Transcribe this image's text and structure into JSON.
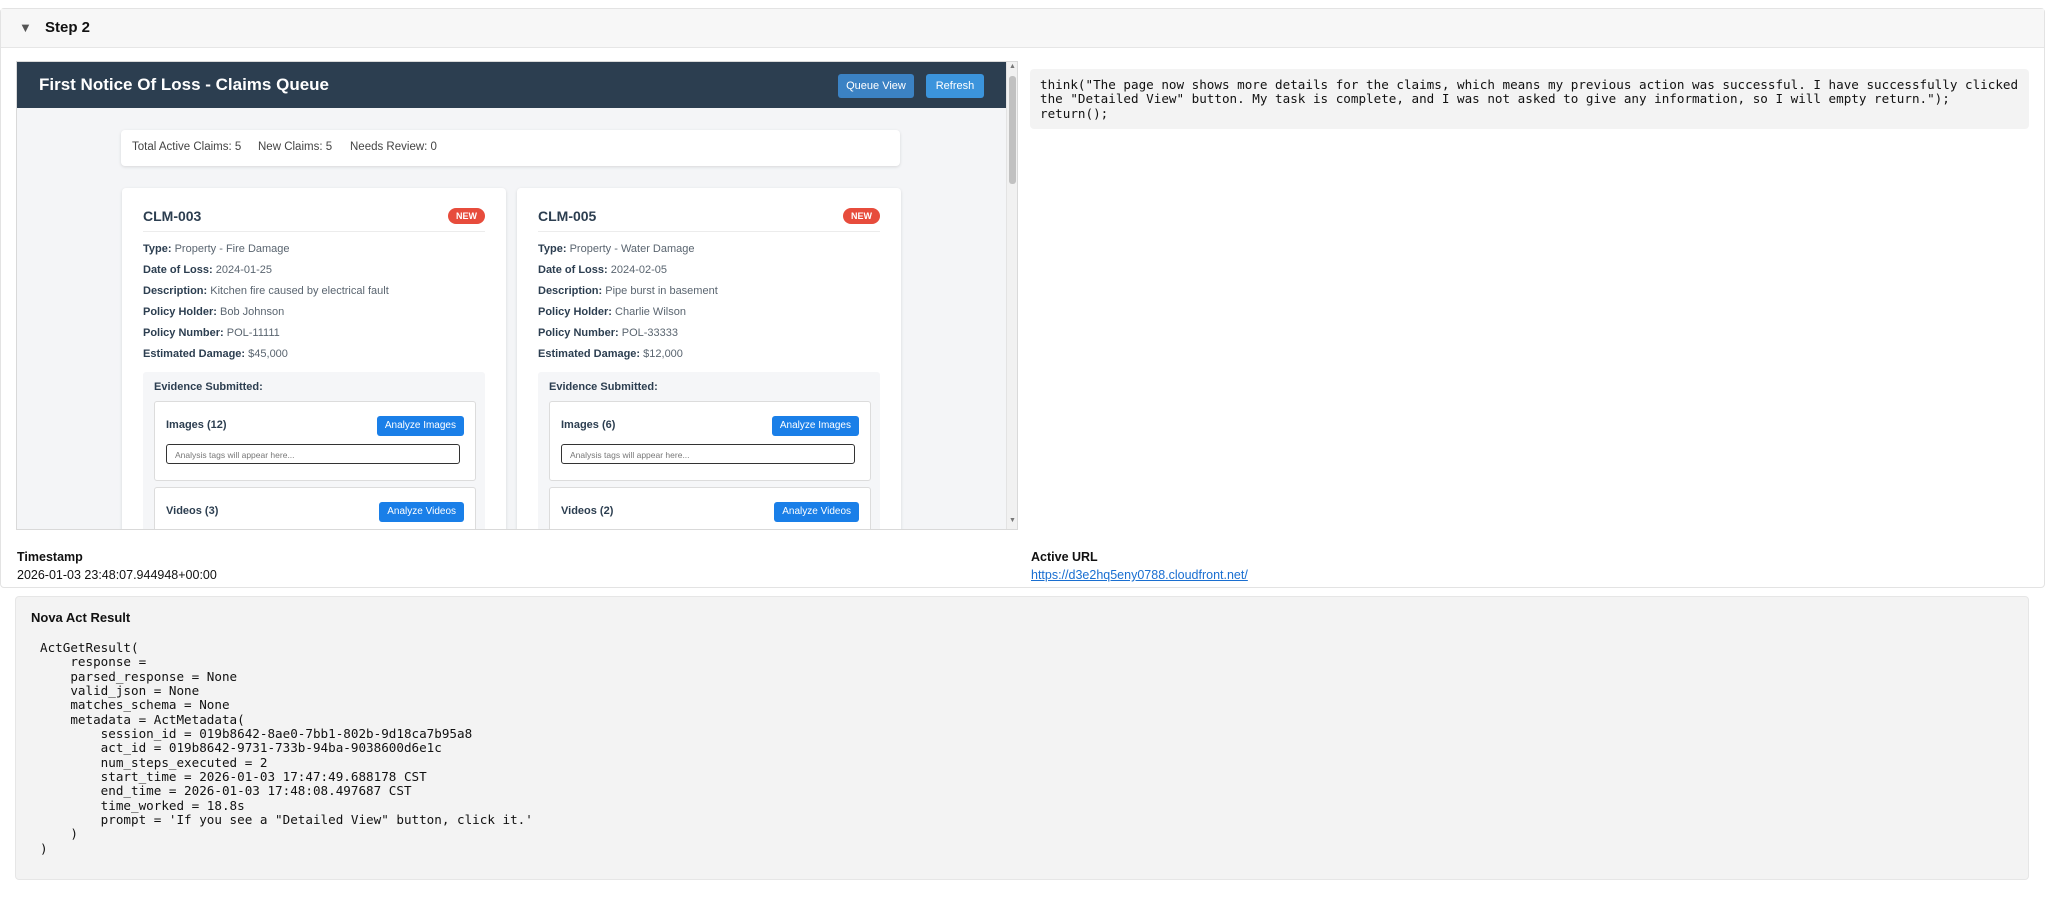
{
  "step": {
    "chevron": "▼",
    "title": "Step 2"
  },
  "app": {
    "title": "First Notice Of Loss - Claims Queue",
    "queue_view_label": "Queue View",
    "refresh_label": "Refresh",
    "stats": [
      "Total Active Claims: 5",
      "New Claims: 5",
      "Needs Review: 0"
    ]
  },
  "field_labels": {
    "type": "Type:",
    "date": "Date of Loss:",
    "description": "Description:",
    "holder": "Policy Holder:",
    "policy": "Policy Number:",
    "damage": "Estimated Damage:",
    "evidence": "Evidence Submitted:"
  },
  "claims": [
    {
      "id": "CLM-003",
      "badge": "NEW",
      "type": "Property - Fire Damage",
      "date": "2024-01-25",
      "description": "Kitchen fire caused by electrical fault",
      "holder": "Bob Johnson",
      "policy": "POL-11111",
      "damage": "$45,000",
      "images_label": "Images (12)",
      "videos_label": "Videos (3)"
    },
    {
      "id": "CLM-005",
      "badge": "NEW",
      "type": "Property - Water Damage",
      "date": "2024-02-05",
      "description": "Pipe burst in basement",
      "holder": "Charlie Wilson",
      "policy": "POL-33333",
      "damage": "$12,000",
      "images_label": "Images (6)",
      "videos_label": "Videos (2)"
    }
  ],
  "evidence": {
    "analyze_images": "Analyze Images",
    "analyze_videos": "Analyze Videos",
    "tags_placeholder": "Analysis tags will appear here..."
  },
  "think_text": "think(\"The page now shows more details for the claims, which means my previous action was successful. I have successfully clicked\nthe \"Detailed View\" button. My task is complete, and I was not asked to give any information, so I will empty return.\");\nreturn();",
  "timestamp": {
    "label": "Timestamp",
    "value": "2026-01-03 23:48:07.944948+00:00"
  },
  "active_url": {
    "label": "Active URL",
    "value": "https://d3e2hq5eny0788.cloudfront.net/"
  },
  "result": {
    "title": "Nova Act Result",
    "code": "ActGetResult(\n    response =\n    parsed_response = None\n    valid_json = None\n    matches_schema = None\n    metadata = ActMetadata(\n        session_id = 019b8642-8ae0-7bb1-802b-9d18ca7b95a8\n        act_id = 019b8642-9731-733b-94ba-9038600d6e1c\n        num_steps_executed = 2\n        start_time = 2026-01-03 17:47:49.688178 CST\n        end_time = 2026-01-03 17:48:08.497687 CST\n        time_worked = 18.8s\n        prompt = 'If you see a \"Detailed View\" button, click it.'\n    )\n)"
  },
  "colors": {
    "app_header": "#2c3e50",
    "primary_button": "#1a7fe8",
    "badge_new": "#e74c3c",
    "link": "#1a6fd1"
  },
  "icons": {
    "collapse": "chevron-down-icon"
  }
}
